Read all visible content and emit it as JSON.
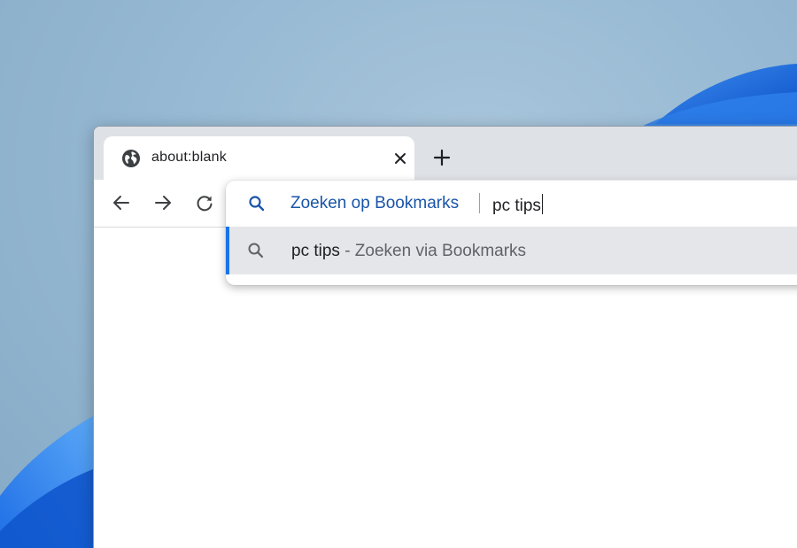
{
  "tab": {
    "title": "about:blank",
    "favicon": "globe-icon",
    "close_icon": "close-icon"
  },
  "tabstrip": {
    "new_tab_icon": "plus-icon"
  },
  "toolbar": {
    "back_icon": "arrow-left-icon",
    "forward_icon": "arrow-right-icon",
    "reload_icon": "reload-icon"
  },
  "omnibox": {
    "keyword_label": "Zoeken op Bookmarks",
    "query": "pc tips",
    "search_icon": "search-icon"
  },
  "suggestions": [
    {
      "query": "pc tips",
      "description": " - Zoeken via Bookmarks",
      "icon": "search-icon"
    }
  ],
  "colors": {
    "keyword": "#1a55a8",
    "selection_accent": "#1a73e8",
    "selected_row": "#e5e6e9",
    "tabstrip": "#dee1e6"
  }
}
